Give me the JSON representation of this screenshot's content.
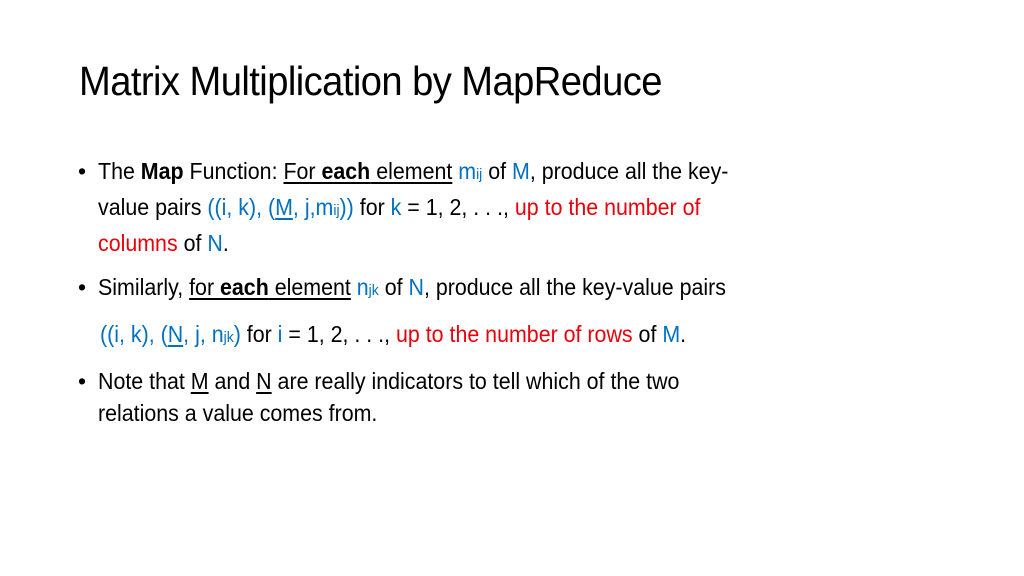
{
  "slide": {
    "title": "Matrix Multiplication by MapReduce",
    "colors": {
      "accent_blue": "#0070C0",
      "accent_red": "#E8000B",
      "text": "#000000"
    },
    "bullets": [
      {
        "bullet_glyph": "•",
        "lines": [
          {
            "t1": "The ",
            "t2": "Map",
            "t3": " Function: ",
            "t4": "For ",
            "t5": "each",
            "t6": " element",
            "t7": " ",
            "t8": "m",
            "t9": "ij",
            "t10": " of ",
            "t11": "M",
            "t12": ", produce all the key-"
          },
          {
            "t1": "value pairs ",
            "t2": "((i, k), (",
            "t3": "M",
            "t4": ", j,m",
            "t5": "ij",
            "t6": "))",
            "t7": " for ",
            "t8": "k",
            "t9": " = 1, 2, . . ., ",
            "t10": "up to the number of"
          },
          {
            "t1": "columns",
            "t2": " of ",
            "t3": "N",
            "t4": "."
          }
        ]
      },
      {
        "bullet_glyph": "•",
        "lines": [
          {
            "t1": "Similarly, ",
            "t2": "for ",
            "t3": "each",
            "t4": " element",
            "t5": " ",
            "t6": "n",
            "t7": "jk",
            "t8": " of ",
            "t9": "N",
            "t10": ", produce all the key-value pairs"
          },
          {
            "t1": "((i, k), (",
            "t2": "N",
            "t3": ", j, n",
            "t4": "jk",
            "t5": ")",
            "t6": " for ",
            "t7": "i",
            "t8": " = 1, 2, . . ., ",
            "t9": "up to the number of rows",
            "t10": " of ",
            "t11": "M",
            "t12": "."
          }
        ]
      },
      {
        "bullet_glyph": "•",
        "lines": [
          {
            "t1": "Note that ",
            "t2": "M",
            "t3": " and ",
            "t4": "N",
            "t5": " are really indicators to tell which of the two"
          },
          {
            "t1": "relations a value comes from."
          }
        ]
      }
    ]
  }
}
